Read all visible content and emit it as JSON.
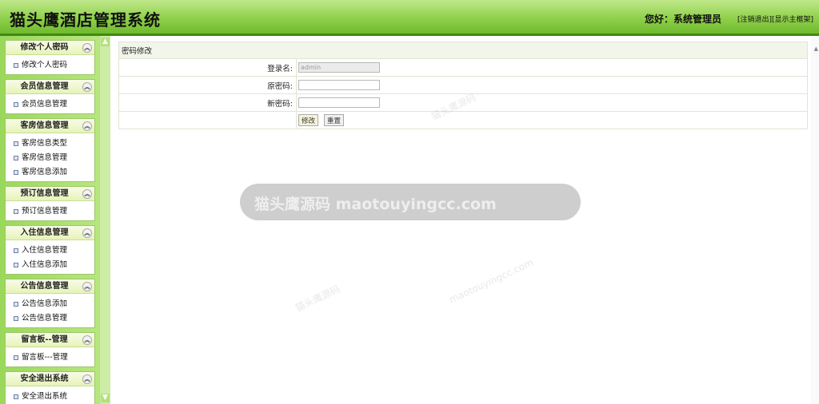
{
  "header": {
    "app_title": "猫头鹰酒店管理系统",
    "greeting": "您好：系统管理员",
    "logout_link": "[注销退出]",
    "show_frame_link": "[显示主框架]"
  },
  "sidebar": {
    "groups": [
      {
        "title": "修改个人密码",
        "items": [
          "修改个人密码"
        ]
      },
      {
        "title": "会员信息管理",
        "items": [
          "会员信息管理"
        ]
      },
      {
        "title": "客房信息管理",
        "items": [
          "客房信息类型",
          "客房信息管理",
          "客房信息添加"
        ]
      },
      {
        "title": "预订信息管理",
        "items": [
          "预订信息管理"
        ]
      },
      {
        "title": "入住信息管理",
        "items": [
          "入住信息管理",
          "入住信息添加"
        ]
      },
      {
        "title": "公告信息管理",
        "items": [
          "公告信息添加",
          "公告信息管理"
        ]
      },
      {
        "title": "留言板--管理",
        "items": [
          "留言板---管理"
        ]
      },
      {
        "title": "安全退出系统",
        "items": [
          "安全退出系统"
        ]
      }
    ]
  },
  "form": {
    "section_title": "密码修改",
    "username_label": "登录名:",
    "username_value": "admin",
    "old_password_label": "原密码:",
    "new_password_label": "新密码:",
    "submit_label": "修改",
    "reset_label": "重置"
  },
  "watermark": {
    "text": "猫头鹰源码 maotouyingcc.com",
    "small_cn": "猫头鹰源码",
    "small_en": "maotouyingcc.com"
  }
}
